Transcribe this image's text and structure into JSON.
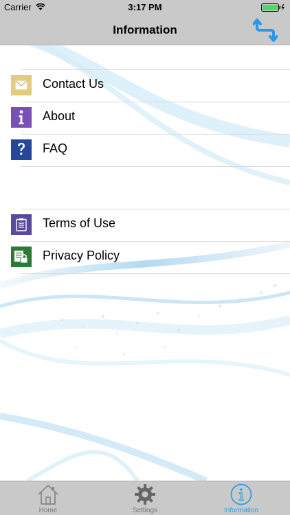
{
  "status_bar": {
    "carrier": "Carrier",
    "time": "3:17 PM"
  },
  "nav": {
    "title": "Information"
  },
  "group1": [
    {
      "label": "Contact Us",
      "icon": "envelope-icon",
      "color": "#e3cc7d"
    },
    {
      "label": "About",
      "icon": "info-icon",
      "color": "#7b4fb8"
    },
    {
      "label": "FAQ",
      "icon": "question-icon",
      "color": "#27479a"
    }
  ],
  "group2": [
    {
      "label": "Terms of Use",
      "icon": "clipboard-icon",
      "color": "#5a4a9c"
    },
    {
      "label": "Privacy Policy",
      "icon": "lock-document-icon",
      "color": "#2b7a35"
    }
  ],
  "tabs": [
    {
      "label": "Home",
      "icon": "house-icon",
      "active": false
    },
    {
      "label": "Settings",
      "icon": "gear-icon",
      "active": false
    },
    {
      "label": "Information",
      "icon": "info-circle-icon",
      "active": true
    }
  ],
  "colors": {
    "bar_background": "#c9c9c9",
    "accent": "#2aa0e4",
    "separator": "#d9d9d9"
  }
}
